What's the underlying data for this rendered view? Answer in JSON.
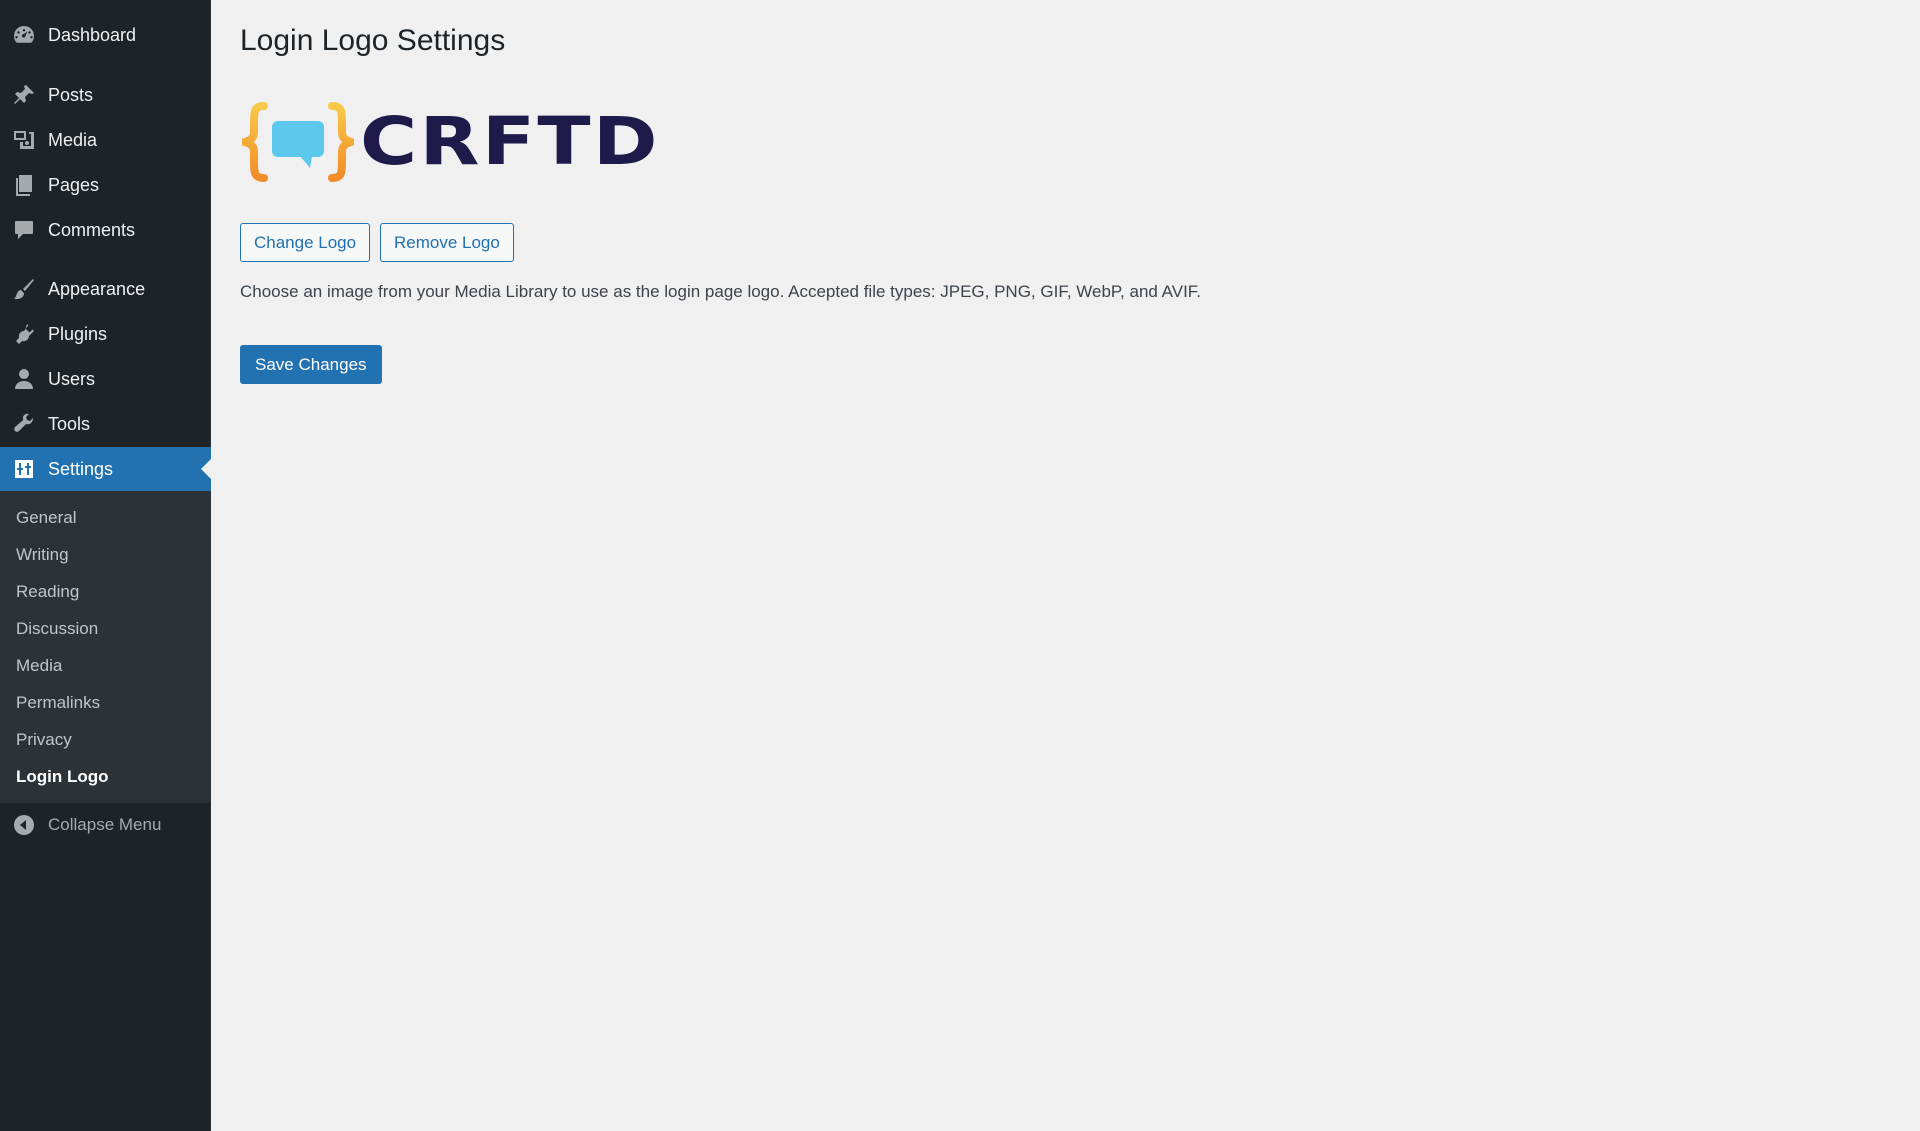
{
  "sidebar": {
    "items": [
      {
        "key": "dashboard",
        "label": "Dashboard",
        "icon": "dashboard-icon"
      },
      {
        "key": "posts",
        "label": "Posts",
        "icon": "pin-icon"
      },
      {
        "key": "media",
        "label": "Media",
        "icon": "media-icon"
      },
      {
        "key": "pages",
        "label": "Pages",
        "icon": "pages-icon"
      },
      {
        "key": "comments",
        "label": "Comments",
        "icon": "comment-icon"
      },
      {
        "key": "appearance",
        "label": "Appearance",
        "icon": "paintbrush-icon"
      },
      {
        "key": "plugins",
        "label": "Plugins",
        "icon": "plugin-icon"
      },
      {
        "key": "users",
        "label": "Users",
        "icon": "user-icon"
      },
      {
        "key": "tools",
        "label": "Tools",
        "icon": "wrench-icon"
      },
      {
        "key": "settings",
        "label": "Settings",
        "icon": "settings-icon",
        "current": true
      }
    ],
    "submenu": [
      {
        "label": "General"
      },
      {
        "label": "Writing"
      },
      {
        "label": "Reading"
      },
      {
        "label": "Discussion"
      },
      {
        "label": "Media"
      },
      {
        "label": "Permalinks"
      },
      {
        "label": "Privacy"
      },
      {
        "label": "Login Logo",
        "current": true
      }
    ],
    "collapse_label": "Collapse Menu"
  },
  "main": {
    "title": "Login Logo Settings",
    "logo_text": "CRFTD",
    "change_logo_label": "Change Logo",
    "remove_logo_label": "Remove Logo",
    "description": "Choose an image from your Media Library to use as the login page logo. Accepted file types: JPEG, PNG, GIF, WebP, and AVIF.",
    "save_label": "Save Changes"
  },
  "colors": {
    "sidebar_bg": "#1d2327",
    "submenu_bg": "#2c3338",
    "accent": "#2271b1",
    "page_bg": "#f0f0f1",
    "logo_navy": "#1e1b4b",
    "logo_orange": "#f5a623",
    "logo_blue": "#5bc8ec"
  }
}
